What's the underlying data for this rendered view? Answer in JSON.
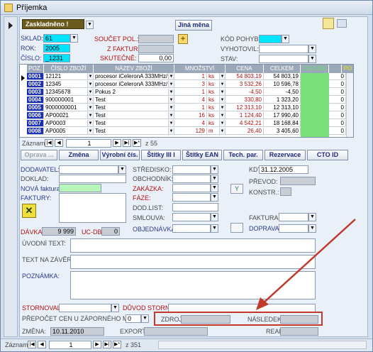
{
  "window": {
    "title": "Příjemka"
  },
  "header": {
    "status": "Zaskladněno !",
    "change_button": "Jiná měna"
  },
  "left": {
    "sklad_label": "SKLAD:",
    "sklad_value": "61",
    "rok_label": "ROK:",
    "rok_value": "2005",
    "cislo_label": "ČÍSLO:",
    "cislo_value": "_1231"
  },
  "middle": {
    "soucet_label": "SOUČET POL.:",
    "zfaktur_label": "Z FAKTUR:",
    "skutecne_label": "SKUTEČNĚ:",
    "skutecne_value": "0,00"
  },
  "right": {
    "kod_label": "KÓD POHYBU:",
    "vyhotovil_label": "VYHOTOVIL:",
    "stav_label": "STAV:"
  },
  "grid": {
    "headers": [
      "POZ.",
      "ČÍSLO ZBOŽÍ",
      "NÁZEV ZBOŽÍ",
      "MNOŽSTVÍ",
      "CENA",
      "CELKEM",
      "CELKEM",
      "",
      "PO"
    ],
    "rows": [
      {
        "poz": "0001",
        "cislo": "12121",
        "nazev": "procesor iCeleronA 333MHz/",
        "mn": "1",
        "jed": "ks",
        "cena": "54 803,19",
        "celkem": "54 803,19",
        "x": "0"
      },
      {
        "poz": "0002",
        "cislo": "12345",
        "nazev": "procesor iCeleronA 333MHz/",
        "mn": "3",
        "jed": "ks",
        "cena": "3 532,26",
        "celkem": "10 596,78",
        "x": "0"
      },
      {
        "poz": "0003",
        "cislo": "12345678",
        "nazev": "Pokus 2",
        "mn": "1",
        "jed": "ks",
        "cena": "-4,50",
        "celkem": "-4,50",
        "x": "0"
      },
      {
        "poz": "0004",
        "cislo": "900000001",
        "nazev": "Test",
        "mn": "4",
        "jed": "ks",
        "cena": "330,80",
        "celkem": "1 323,20",
        "x": "0"
      },
      {
        "poz": "0005",
        "cislo": "9000000001",
        "nazev": "Test",
        "mn": "1",
        "jed": "ks",
        "cena": "12 313,10",
        "celkem": "12 313,10",
        "x": "0"
      },
      {
        "poz": "0006",
        "cislo": "AP00021",
        "nazev": "Test",
        "mn": "16",
        "jed": "ks",
        "cena": "1 124,40",
        "celkem": "17 990,40",
        "x": "0"
      },
      {
        "poz": "0007",
        "cislo": "AP0003",
        "nazev": "Test",
        "mn": "4",
        "jed": "ks",
        "cena": "4 542,21",
        "celkem": "18 168,84",
        "x": "0"
      },
      {
        "poz": "0008",
        "cislo": "AP0005",
        "nazev": "Test",
        "mn": "129",
        "jed": "m",
        "cena": "26,40",
        "celkem": "3 405,60",
        "x": "0"
      }
    ]
  },
  "grid_nav": {
    "label": "Záznam:",
    "current": "1",
    "total": "z 55"
  },
  "buttons": {
    "oprava": "Oprava ...",
    "zmena": "Změna",
    "vyrobni": "Výrobní čís.",
    "stitky": "Štítky III I",
    "stitky_ean": "Štítky EAN",
    "tech": "Tech. par.",
    "rezervace": "Rezervace",
    "cto": "CTO ID"
  },
  "form": {
    "dodavatel": "DODAVATEL:",
    "doklad": "DOKLAD:",
    "nova_faktura": "NOVÁ faktura:",
    "faktury": "FAKTURY:",
    "davka": "DÁVKA:",
    "davka_value": "9 999",
    "ucdb": "UC-DB:",
    "ucdb_value": "0",
    "stredisko": "STŘEDISKO:",
    "obchodnik": "OBCHODNÍK:",
    "zakazka": "ZAKÁZKA:",
    "faze": "FÁZE:",
    "dodlist": "DOD.LIST:",
    "smlouva": "SMLOUVA:",
    "objednavka": "OBJEDNÁVKA:",
    "kdy": "KDY:",
    "kdy_value": "31.12.2005",
    "prevod": "PŘEVOD:",
    "konstr": "KONSTR.:",
    "faktura": "FAKTURA:",
    "doprava": "DOPRAVA:",
    "uvodni": "ÚVODNÍ TEXT:",
    "zaver": "TEXT NA ZÁVĚR:",
    "poznamka": "POZNÁMKA:",
    "stornoval": "STORNOVAL:",
    "duvod": "DŮVOD STORNA:",
    "prepocet": "PŘEPOČET CEN U ZÁPORNÉHO MNOŽ.:",
    "prepocet_value": "0",
    "zdroj": "ZDROJ:",
    "nasledek": "NÁSLEDEK:",
    "zmena": "ZMĚNA:",
    "zmena_value": "10.11.2010",
    "export": "EXPORT:",
    "real": "REAL:"
  },
  "bottom_nav": {
    "label": "Záznam:",
    "current": "1",
    "total": "z 351"
  },
  "colors": {
    "highlight_border": "#c0392b",
    "arrow": "#c0392b",
    "status_bg": "#6b5a1c"
  }
}
